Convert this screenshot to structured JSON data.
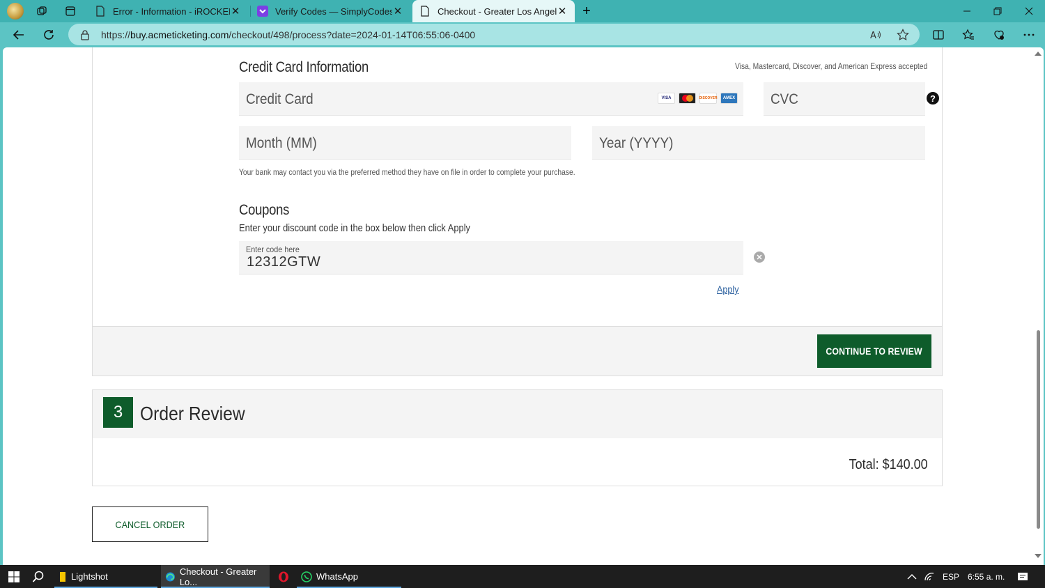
{
  "browser": {
    "tabs": [
      {
        "title": "Error - Information - iROCKER US",
        "active": false
      },
      {
        "title": "Verify Codes — SimplyCodes",
        "active": false
      },
      {
        "title": "Checkout - Greater Los Angeles Zoo",
        "active": true
      }
    ],
    "new_tab_symbol": "+",
    "url_prefix": "https://",
    "url_domain": "buy.acmeticketing.com",
    "url_path": "/checkout/498/process?date=2024-01-14T06:55:06-0400"
  },
  "credit_card": {
    "heading": "Credit Card Information",
    "accepted_note": "Visa, Mastercard, Discover, and American Express accepted",
    "card_placeholder": "Credit Card",
    "cvc_placeholder": "CVC",
    "month_placeholder": "Month (MM)",
    "year_placeholder": "Year (YYYY)",
    "bank_note": "Your bank may contact you via the preferred method they have on file in order to complete your purchase.",
    "help_symbol": "?"
  },
  "card_logos": [
    "VISA",
    "MC",
    "DISCOVER",
    "AMEX"
  ],
  "coupons": {
    "heading": "Coupons",
    "instructions": "Enter your discount code in the box below then click Apply",
    "field_label": "Enter code here",
    "field_value": "12312GTW",
    "apply_label": "Apply"
  },
  "actions": {
    "continue_label": "CONTINUE TO REVIEW",
    "cancel_label": "CANCEL ORDER"
  },
  "order_review": {
    "step_number": "3",
    "title": "Order Review",
    "total": "Total: $140.00"
  },
  "taskbar": {
    "items": [
      {
        "label": "Lightshot"
      },
      {
        "label": "Checkout - Greater Lo..."
      },
      {
        "label": "WhatsApp"
      }
    ],
    "language": "ESP",
    "time": "6:55 a. m."
  },
  "colors": {
    "brand_green": "#0e5c2b",
    "browser_teal": "#5cc4c4"
  }
}
